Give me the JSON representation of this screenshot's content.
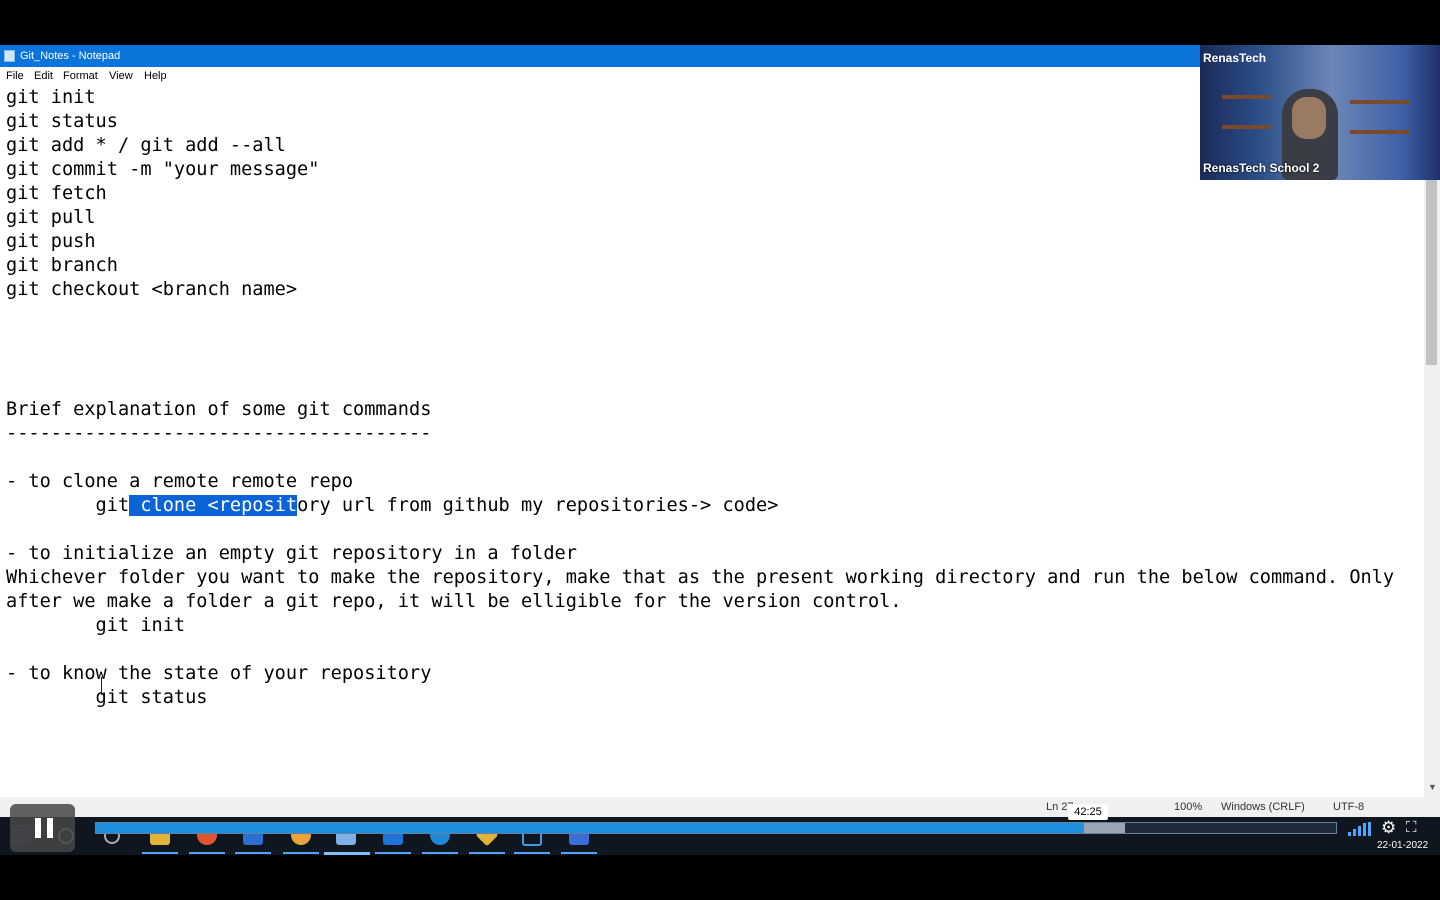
{
  "window": {
    "title": "Git_Notes - Notepad"
  },
  "menu": [
    "File",
    "Edit",
    "Format",
    "View",
    "Help"
  ],
  "editor": {
    "lines_top": [
      "git init",
      "git status",
      "git add * / git add --all",
      "git commit -m \"your message\"",
      "git fetch",
      "git pull",
      "git push",
      "git branch",
      "git checkout <branch name>",
      "",
      "",
      "",
      "",
      "Brief explanation of some git commands",
      "--------------------------------------",
      "",
      "- to clone a remote remote repo"
    ],
    "clone_line": {
      "before": "        git",
      "selected": " clone <reposit",
      "after": "ory url from github my repositories-> code>"
    },
    "lines_bottom": [
      "",
      "- to initialize an empty git repository in a folder",
      "Whichever folder you want to make the repository, make that as the present working directory and run the below command. Only",
      "after we make a folder a git repo, it will be elligible for the version control.",
      "        git init",
      "",
      "- to know the state of your repository",
      "        git status"
    ]
  },
  "webcam": {
    "brand": "RenasTech",
    "name": "RenasTech School 2"
  },
  "statusbar": {
    "position": "Ln 27",
    "zoom": "100%",
    "line_ending": "Windows (CRLF)",
    "encoding": "UTF-8"
  },
  "video": {
    "time": "42:25",
    "progress_fraction": 0.797,
    "buffered_fraction": 0.83,
    "date": "22-01-2022"
  },
  "icons": {
    "pause": "pause-icon",
    "settings": "gear-icon",
    "fullscreen": "fullscreen-icon",
    "signal": "signal-bars-icon",
    "taskbar": [
      "windows-start-icon",
      "search-icon",
      "cortana-icon",
      "file-explorer-icon",
      "firefox-icon",
      "app-icon",
      "chrome-icon",
      "notepad-icon",
      "outlook-icon",
      "edge-icon",
      "git-icon",
      "window-icon",
      "editor-icon"
    ]
  },
  "colors": {
    "titlebar": "#0a74da",
    "selection": "#0a64d6",
    "progress": "#1f8fe0"
  }
}
